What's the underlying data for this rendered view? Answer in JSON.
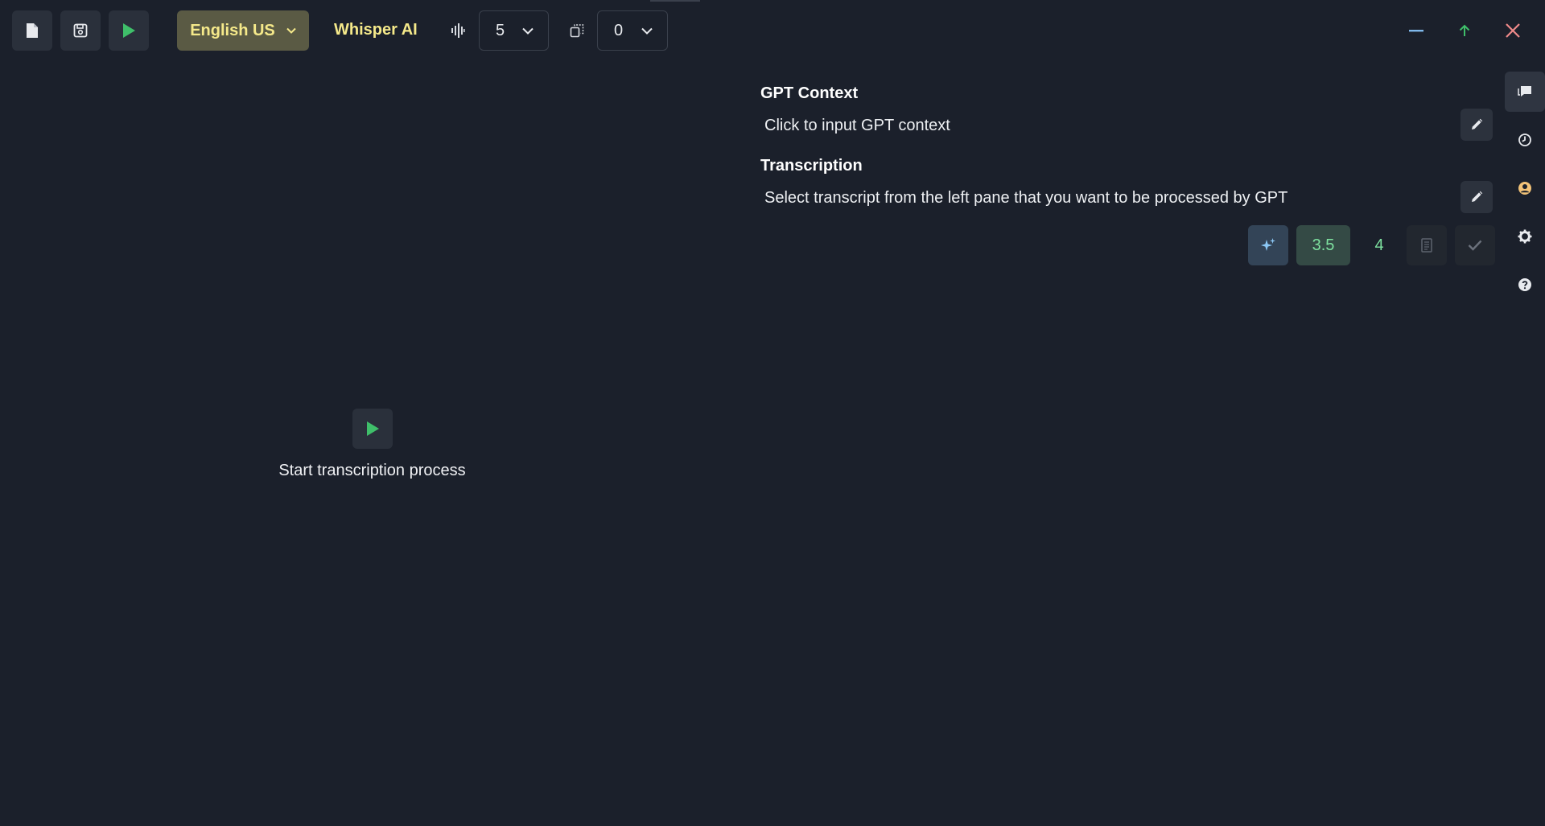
{
  "toolbar": {
    "new_file_icon": "file-icon",
    "save_icon": "save-icon",
    "play_icon": "play-icon",
    "language": "English US",
    "model": "Whisper AI",
    "beam_size": "5",
    "offset": "0"
  },
  "window_controls": {
    "minimize_icon": "minimize-icon",
    "pin_icon": "arrow-up-icon",
    "close_icon": "close-icon"
  },
  "left_pane": {
    "start_label": "Start transcription process"
  },
  "gpt_pane": {
    "context_title": "GPT Context",
    "context_text": "Click to input GPT context",
    "transcription_title": "Transcription",
    "transcription_text": "Select transcript from the left pane that you want to be processed by GPT",
    "model_35": "3.5",
    "model_4": "4"
  },
  "sidebar": {
    "items": [
      "chat-icon",
      "history-icon",
      "user-icon",
      "settings-icon",
      "help-icon"
    ]
  },
  "colors": {
    "background": "#1b202b",
    "accent_yellow": "#f5e98a",
    "accent_green": "#3fbf6a",
    "close_red": "#ef8a8a"
  }
}
